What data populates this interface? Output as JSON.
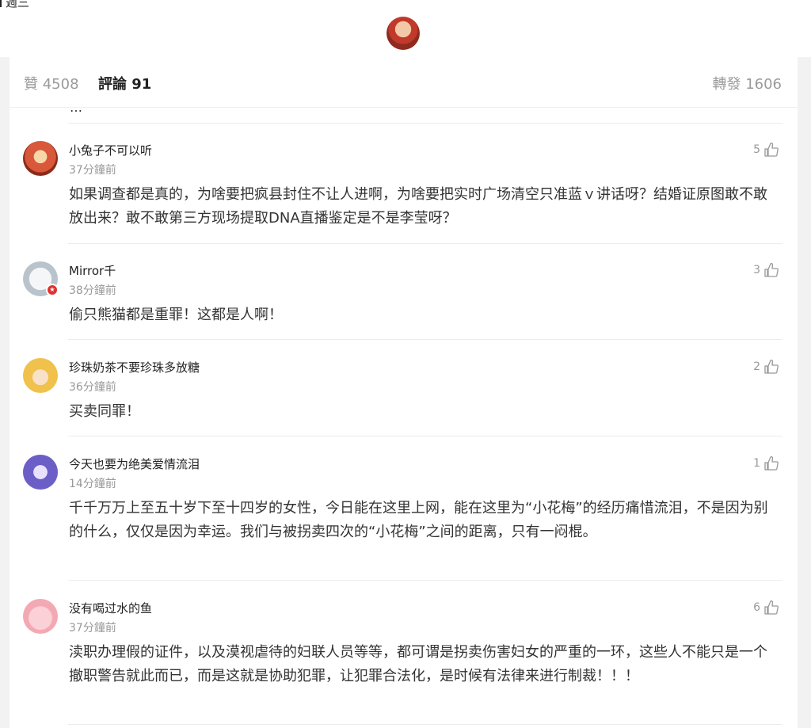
{
  "header": {
    "day_label": "週三"
  },
  "tabs": {
    "likes": "贊 4508",
    "comments": "評論 91",
    "reposts": "轉發 1606"
  },
  "peek_text": "…",
  "comments": [
    {
      "name": "小兔子不可以听",
      "time": "37分鐘前",
      "likes": "5",
      "body": "如果调查都是真的，为啥要把疯县封住不让人进啊，为啥要把实时广场清空只准蓝ｖ讲话呀？结婚证原图敢不敢放出来？敢不敢第三方现场提取DNA直播鉴定是不是李莹呀？",
      "avatar_color": "#d9573a"
    },
    {
      "name": "Mirror千",
      "time": "38分鐘前",
      "likes": "3",
      "body": "偷只熊猫都是重罪！这都是人啊！",
      "avatar_color": "#cfd6de"
    },
    {
      "name": "珍珠奶茶不要珍珠多放糖",
      "time": "36分鐘前",
      "likes": "2",
      "body": "买卖同罪！",
      "avatar_color": "#f0c14b"
    },
    {
      "name": "今天也要为绝美爱情流泪",
      "time": "14分鐘前",
      "likes": "1",
      "body": "千千万万上至五十岁下至十四岁的女性，今日能在这里上网，能在这里为“小花梅”的经历痛惜流泪，不是因为别的什么，仅仅是因为幸运。我们与被拐卖四次的“小花梅”之间的距离，只有一闷棍。",
      "avatar_color": "#6b5fc7"
    },
    {
      "name": "没有喝过水的鱼",
      "time": "37分鐘前",
      "likes": "6",
      "body": "渎职办理假的证件，以及漠视虐待的妇联人员等等，都可谓是拐卖伤害妇女的严重的一环，这些人不能只是一个撤职警告就此而已，而是这就是协助犯罪，让犯罪合法化，是时候有法律来进行制裁！！！",
      "avatar_color": "#f3b9c0"
    }
  ],
  "colors": {
    "muted": "#999999",
    "text": "#333333",
    "badge": "#e0322d"
  },
  "icons": {
    "like": "thumbs-up-icon",
    "verified": "verified-badge-icon"
  }
}
